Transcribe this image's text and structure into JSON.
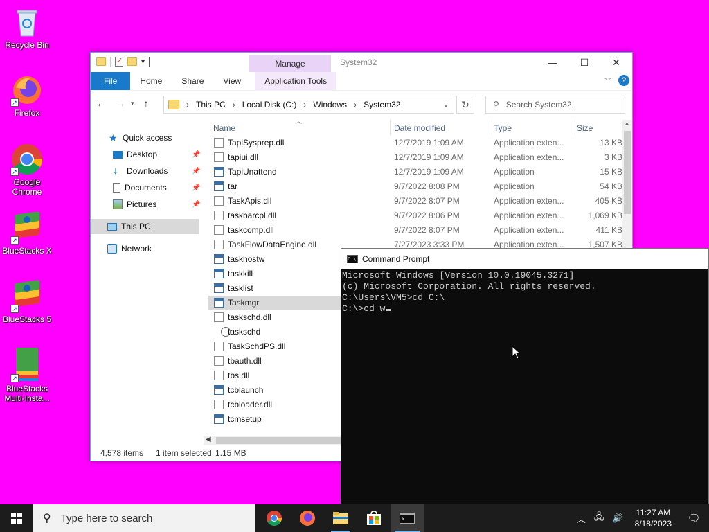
{
  "desktop": {
    "icons": [
      {
        "label": "Recycle Bin"
      },
      {
        "label": "Firefox"
      },
      {
        "label": "Google Chrome"
      },
      {
        "label": "BlueStacks X"
      },
      {
        "label": "BlueStacks 5"
      },
      {
        "label": "BlueStacks Multi-Insta..."
      }
    ]
  },
  "explorer": {
    "title": "System32",
    "manage_label": "Manage",
    "ribbon_tabs": [
      "File",
      "Home",
      "Share",
      "View",
      "Application Tools"
    ],
    "breadcrumb": [
      "This PC",
      "Local Disk (C:)",
      "Windows",
      "System32"
    ],
    "search_placeholder": "Search System32",
    "nav": {
      "quick_access": "Quick access",
      "desktop": "Desktop",
      "downloads": "Downloads",
      "documents": "Documents",
      "pictures": "Pictures",
      "this_pc": "This PC",
      "network": "Network"
    },
    "columns": {
      "name": "Name",
      "date": "Date modified",
      "type": "Type",
      "size": "Size"
    },
    "files": [
      {
        "name": "TapiSysprep.dll",
        "date": "12/7/2019 1:09 AM",
        "type": "Application exten...",
        "size": "13 KB",
        "icon": "dll"
      },
      {
        "name": "tapiui.dll",
        "date": "12/7/2019 1:09 AM",
        "type": "Application exten...",
        "size": "3 KB",
        "icon": "dll"
      },
      {
        "name": "TapiUnattend",
        "date": "12/7/2019 1:09 AM",
        "type": "Application",
        "size": "15 KB",
        "icon": "app"
      },
      {
        "name": "tar",
        "date": "9/7/2022 8:08 PM",
        "type": "Application",
        "size": "54 KB",
        "icon": "app"
      },
      {
        "name": "TaskApis.dll",
        "date": "9/7/2022 8:07 PM",
        "type": "Application exten...",
        "size": "405 KB",
        "icon": "dll"
      },
      {
        "name": "taskbarcpl.dll",
        "date": "9/7/2022 8:06 PM",
        "type": "Application exten...",
        "size": "1,069 KB",
        "icon": "dll"
      },
      {
        "name": "taskcomp.dll",
        "date": "9/7/2022 8:07 PM",
        "type": "Application exten...",
        "size": "411 KB",
        "icon": "dll"
      },
      {
        "name": "TaskFlowDataEngine.dll",
        "date": "7/27/2023 3:33 PM",
        "type": "Application exten...",
        "size": "1,507 KB",
        "icon": "dll"
      },
      {
        "name": "taskhostw",
        "date": "",
        "type": "",
        "size": "",
        "icon": "app"
      },
      {
        "name": "taskkill",
        "date": "",
        "type": "",
        "size": "",
        "icon": "app"
      },
      {
        "name": "tasklist",
        "date": "",
        "type": "",
        "size": "",
        "icon": "app"
      },
      {
        "name": "Taskmgr",
        "date": "",
        "type": "",
        "size": "",
        "icon": "app",
        "selected": true
      },
      {
        "name": "taskschd.dll",
        "date": "",
        "type": "",
        "size": "",
        "icon": "dll"
      },
      {
        "name": "taskschd",
        "date": "",
        "type": "",
        "size": "",
        "icon": "clock"
      },
      {
        "name": "TaskSchdPS.dll",
        "date": "",
        "type": "",
        "size": "",
        "icon": "dll"
      },
      {
        "name": "tbauth.dll",
        "date": "",
        "type": "",
        "size": "",
        "icon": "dll"
      },
      {
        "name": "tbs.dll",
        "date": "",
        "type": "",
        "size": "",
        "icon": "dll"
      },
      {
        "name": "tcblaunch",
        "date": "",
        "type": "",
        "size": "",
        "icon": "app"
      },
      {
        "name": "tcbloader.dll",
        "date": "",
        "type": "",
        "size": "",
        "icon": "dll"
      },
      {
        "name": "tcmsetup",
        "date": "",
        "type": "",
        "size": "",
        "icon": "app"
      }
    ],
    "status": {
      "items": "4,578 items",
      "selected": "1 item selected",
      "size": "1.15 MB"
    }
  },
  "cmd": {
    "title": "Command Prompt",
    "lines": [
      "Microsoft Windows [Version 10.0.19045.3271]",
      "(c) Microsoft Corporation. All rights reserved.",
      "",
      "C:\\Users\\VM5>cd C:\\",
      "",
      "C:\\>cd w"
    ]
  },
  "taskbar": {
    "search_placeholder": "Type here to search",
    "time": "11:27 AM",
    "date": "8/18/2023"
  }
}
